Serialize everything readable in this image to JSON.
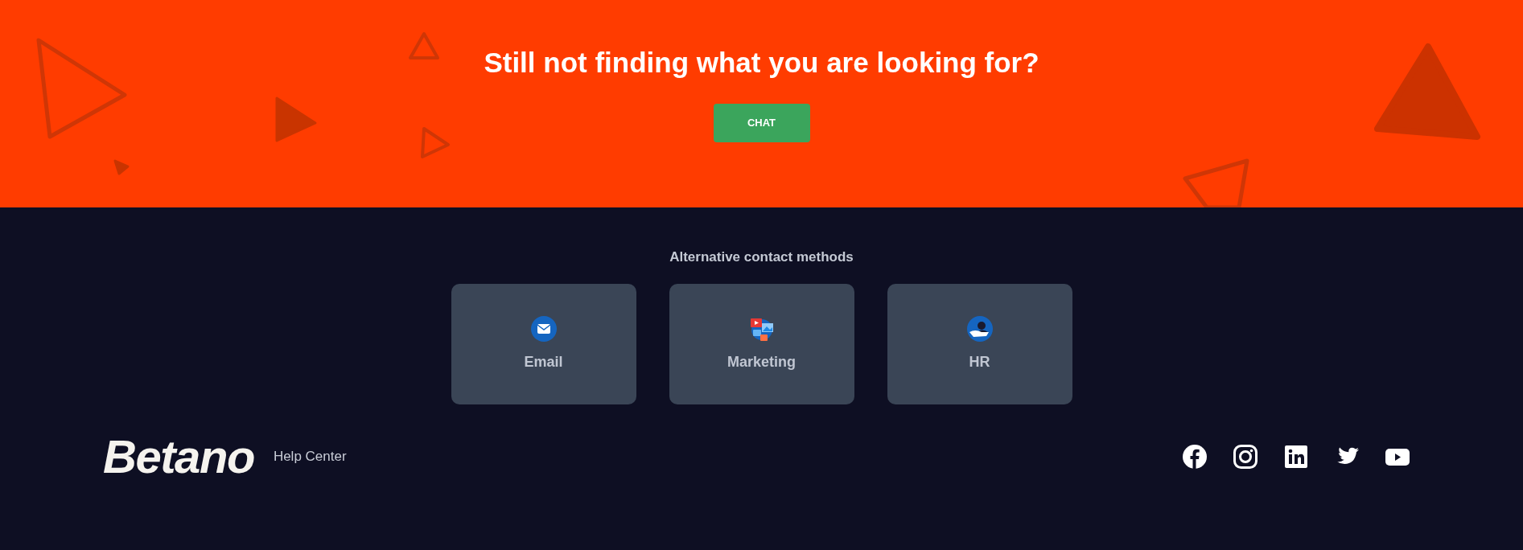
{
  "banner": {
    "title": "Still not finding what you are looking for?",
    "button": "CHAT"
  },
  "contact": {
    "heading": "Alternative contact methods",
    "methods": [
      {
        "kind": "email",
        "label": "Email"
      },
      {
        "kind": "marketing",
        "label": "Marketing"
      },
      {
        "kind": "hr",
        "label": "HR"
      }
    ]
  },
  "footer": {
    "logo": "Betano",
    "link": "Help Center",
    "social": [
      {
        "kind": "facebook"
      },
      {
        "kind": "instagram"
      },
      {
        "kind": "linkedin"
      },
      {
        "kind": "twitter"
      },
      {
        "kind": "youtube"
      }
    ]
  }
}
